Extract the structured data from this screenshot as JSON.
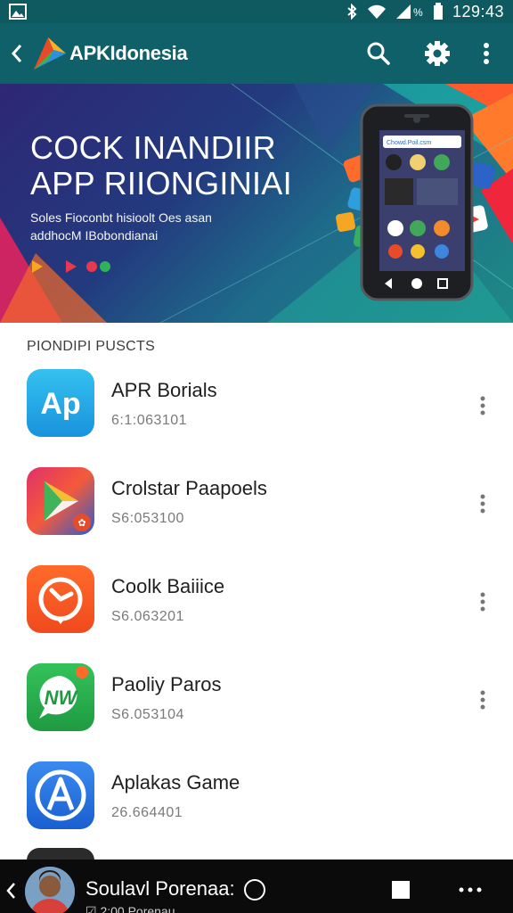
{
  "status_bar": {
    "time": "129:43",
    "icons": [
      "image-icon",
      "bluetooth-icon",
      "wifi-icon",
      "signal-icon",
      "battery-icon"
    ]
  },
  "app_bar": {
    "title": "APKIdonesia",
    "icons": [
      "back-icon",
      "logo-icon",
      "search-icon",
      "settings-icon",
      "more-vert-icon"
    ],
    "color": "#0f6068"
  },
  "banner": {
    "title": "COCK INANDIIR\nAPP RIIONGINIAI",
    "subtitle": "Soles Fioconbt hisioolt Oes asan\naddhocM IBobondianai",
    "phone_url": "Chowd.Poil.csm"
  },
  "section": {
    "header": "PIONDIPI PUSCTS"
  },
  "apps": [
    {
      "name": "APR Borials",
      "meta": "6:1:063101",
      "icon": "ap-app-icon"
    },
    {
      "name": "Crolstar Paapoels",
      "meta": "S6:053100",
      "icon": "play-store-app-icon"
    },
    {
      "name": "Coolk Baiiice",
      "meta": "S6.063201",
      "icon": "clock-app-icon"
    },
    {
      "name": "Paoliy Paros",
      "meta": "S6.053104",
      "icon": "chat-app-icon"
    },
    {
      "name": "Aplakas Game",
      "meta": "26.664401",
      "icon": "a-app-icon"
    }
  ],
  "bottom_bar": {
    "name": "Soulavl Porenaa:",
    "subtitle": "☑ 2:00 Porenau",
    "icons": [
      "back-icon",
      "avatar",
      "circle-icon",
      "square-icon",
      "more-horiz-icon"
    ]
  }
}
